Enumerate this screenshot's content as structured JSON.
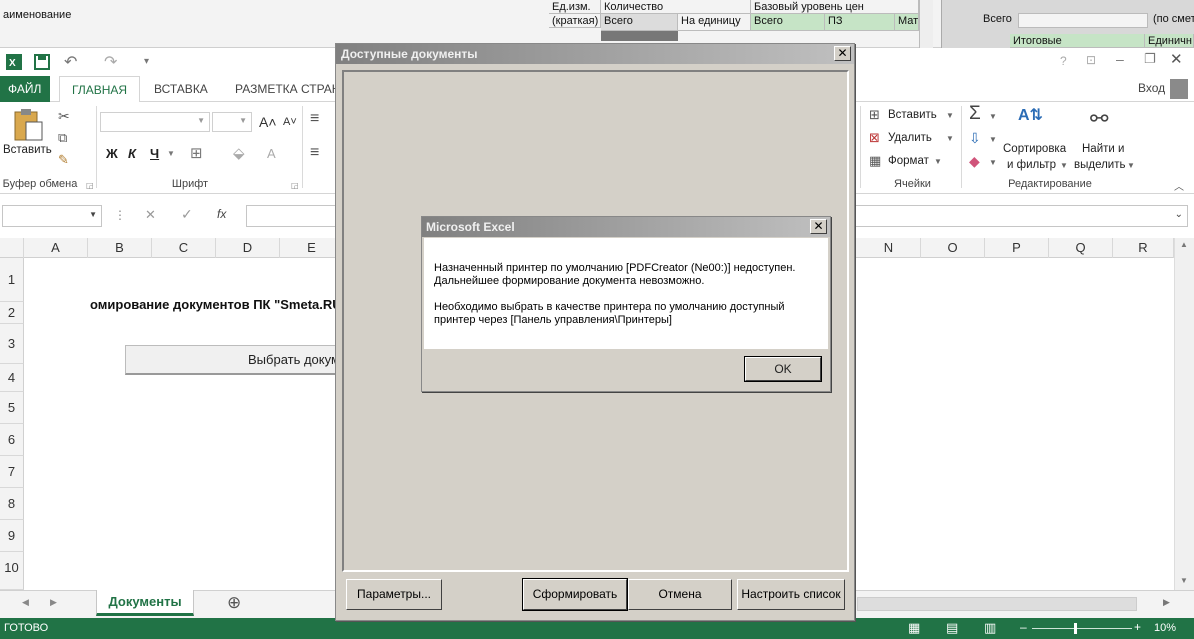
{
  "bg_sheet": {
    "name_col": "аименование",
    "unit_col": "Ед.изм.",
    "unit_sub": "(краткая)",
    "qty_header": "Количество",
    "qty_total": "Всего",
    "qty_per_unit": "На единицу",
    "base_level": "Базовый уровень цен",
    "base_total": "Всего",
    "base_pz": "ПЗ",
    "base_mat": "Мат",
    "right_total": "Всего",
    "right_extra": "(по смет",
    "right_final": "Итоговые",
    "right_unit": "Единичн"
  },
  "window": {
    "help": "?",
    "account": "Вход"
  },
  "ribbon_tabs": [
    "ФАЙЛ",
    "ГЛАВНАЯ",
    "ВСТАВКА",
    "РАЗМЕТКА СТРАН"
  ],
  "ribbon": {
    "paste": "Вставить",
    "clipboard_group": "Буфер обмена",
    "font_group": "Шрифт",
    "bold": "Ж",
    "italic": "К",
    "underline": "Ч",
    "insert": "Вставить",
    "delete": "Удалить",
    "format": "Формат",
    "cells_group": "Ячейки",
    "sort_line1": "Сортировка",
    "sort_line2": "и фильтр",
    "find_line1": "Найти и",
    "find_line2": "выделить",
    "editing_group": "Редактирование"
  },
  "formula": {
    "fx": "fx"
  },
  "columns": [
    "A",
    "B",
    "C",
    "D",
    "E",
    "N",
    "O",
    "P",
    "Q",
    "R"
  ],
  "rows": [
    "1",
    "2",
    "3",
    "4",
    "5",
    "6",
    "7",
    "8",
    "9",
    "10"
  ],
  "sheet": {
    "title_text": "омирование документов ПК \"Smeta.RU",
    "select_button": "Выбрать докум",
    "active_tab": "Документы",
    "add_tab": "⊕"
  },
  "status": {
    "ready": "ГОТОВО",
    "zoom": "10%"
  },
  "form": {
    "title": "Доступные документы",
    "close": "✕",
    "params_button": "Параметры...",
    "generate_button": "Сформировать",
    "cancel_button": "Отмена",
    "configure_button": "Настроить список"
  },
  "msgbox": {
    "title": "Microsoft Excel",
    "close": "✕",
    "line1": "Назначенный принтер по умолчанию [PDFCreator (Ne00:)] недоступен.",
    "line2": "Дальнейшее формирование документа невозможно.",
    "line3": "Необходимо выбрать в качестве принтера по умолчанию доступный",
    "line4": "принтер через [Панель управления\\Принтеры]",
    "ok": "OK"
  },
  "colors": {
    "excel_green": "#217346",
    "dialog_face": "#d4d0c8"
  }
}
